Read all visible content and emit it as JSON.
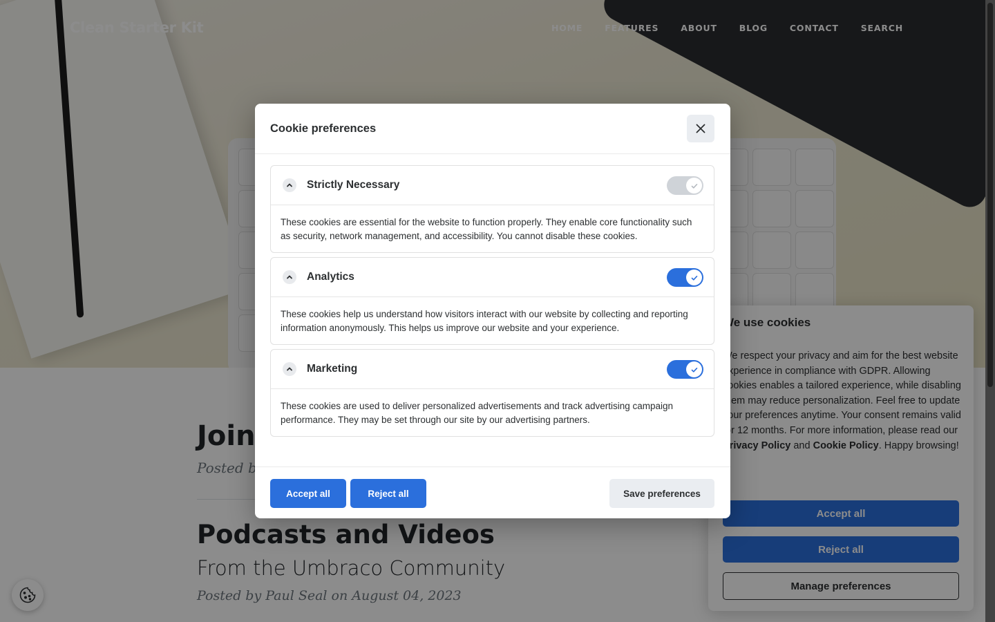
{
  "site": {
    "brand": "Clean Starter Kit",
    "nav": [
      "HOME",
      "FEATURES",
      "ABOUT",
      "BLOG",
      "CONTACT",
      "SEARCH"
    ]
  },
  "posts": [
    {
      "title": "Join t",
      "meta": "Posted by"
    },
    {
      "title": "Podcasts and Videos",
      "subtitle": "From the Umbraco Community",
      "meta": "Posted by Paul Seal on August 04, 2023"
    }
  ],
  "consent_banner": {
    "title": "We use cookies",
    "text_before": "We respect your privacy and aim for the best website experience in compliance with GDPR. Allowing cookies enables a tailored experience, while disabling them may reduce personalization. Feel free to update your preferences anytime. Your consent remains valid for 12 months. For more information, please read our ",
    "privacy_link": "Privacy Policy",
    "and": " and ",
    "cookie_link": "Cookie Policy",
    "text_after": ". Happy browsing!",
    "accept_label": "Accept all",
    "reject_label": "Reject all",
    "manage_label": "Manage preferences"
  },
  "modal": {
    "title": "Cookie preferences",
    "sections": [
      {
        "title": "Strictly Necessary",
        "enabled": true,
        "readonly": true,
        "description": "These cookies are essential for the website to function properly. They enable core functionality such as security, network management, and accessibility. You cannot disable these cookies."
      },
      {
        "title": "Analytics",
        "enabled": true,
        "readonly": false,
        "description": "These cookies help us understand how visitors interact with our website by collecting and reporting information anonymously. This helps us improve our website and your experience."
      },
      {
        "title": "Marketing",
        "enabled": true,
        "readonly": false,
        "description": "These cookies are used to deliver personalized advertisements and track advertising campaign performance. They may be set through our site by our advertising partners."
      }
    ],
    "footer": {
      "accept_label": "Accept all",
      "reject_label": "Reject all",
      "save_label": "Save preferences"
    }
  },
  "colors": {
    "primary": "#2b6fdc",
    "secondary_button": "#eaedf1",
    "text": "#2c2f31"
  }
}
